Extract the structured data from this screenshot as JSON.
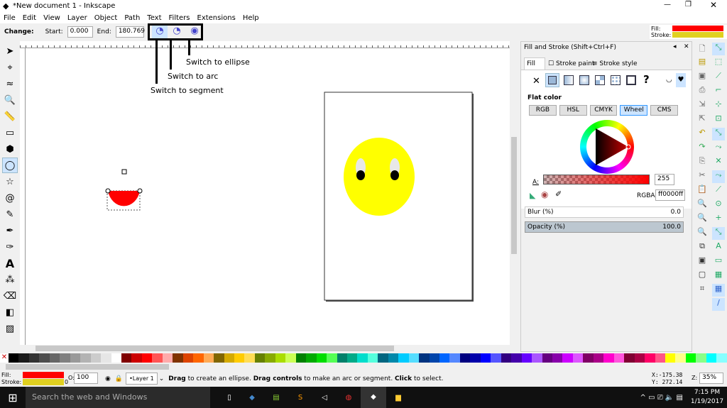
{
  "window": {
    "title": "*New document 1 - Inkscape"
  },
  "menu": [
    "File",
    "Edit",
    "View",
    "Layer",
    "Object",
    "Path",
    "Text",
    "Filters",
    "Extensions",
    "Help"
  ],
  "controls": {
    "change_label": "Change:",
    "start_label": "Start:",
    "start_value": "0.000",
    "end_label": "End:",
    "end_value": "180.769"
  },
  "annotations": {
    "ellipse": "Switch to ellipse",
    "arc": "Switch to arc",
    "segment": "Switch to segment"
  },
  "indicator": {
    "fill_label": "Fill:",
    "stroke_label": "Stroke:",
    "fill_color": "#ff0000",
    "stroke_color": "#e0d020"
  },
  "dock": {
    "title": "Fill and Stroke (Shift+Ctrl+F)",
    "tabs": [
      "Fill",
      "Stroke paint",
      "Stroke style"
    ],
    "paint_type": "Flat color",
    "modes": [
      "RGB",
      "HSL",
      "CMYK",
      "Wheel",
      "CMS"
    ],
    "active_mode": "Wheel",
    "alpha_label": "A:",
    "alpha_value": "255",
    "rgba_label": "RGBA:",
    "rgba_value": "ff0000ff",
    "blur_label": "Blur (%)",
    "blur_value": "0.0",
    "opacity_label": "Opacity (%)",
    "opacity_value": "100.0"
  },
  "status": {
    "fill_label": "Fill:",
    "stroke_label": "Stroke:",
    "stroke_width": "0",
    "opacity_label": "O:",
    "opacity_value": "100",
    "layer": "•Layer 1",
    "message_parts": [
      "Drag",
      " to create an ellipse. ",
      "Drag controls",
      " to make an arc or segment. ",
      "Click",
      " to select."
    ],
    "x_label": "X:",
    "x_value": "-175.38",
    "y_label": "Y:",
    "y_value": "272.14",
    "zoom_label": "Z:",
    "zoom_value": "35%"
  },
  "taskbar": {
    "search_placeholder": "Search the web and Windows",
    "time": "7:15 PM",
    "date": "1/19/2017"
  },
  "palette": [
    "#000000",
    "#1a1a1a",
    "#333",
    "#4d4d4d",
    "#666",
    "#808080",
    "#999",
    "#b3b3b3",
    "#ccc",
    "#e6e6e6",
    "#fff",
    "#800000",
    "#c00",
    "#f00",
    "#f55",
    "#faa",
    "#803300",
    "#d40",
    "#f60",
    "#fa5",
    "#806600",
    "#d4aa00",
    "#fc0",
    "#fd5",
    "#668000",
    "#8a0",
    "#ad0",
    "#cf5",
    "#008000",
    "#0a0",
    "#0d0",
    "#5f5",
    "#00806a",
    "#0a8",
    "#0dc",
    "#5fd",
    "#006680",
    "#08a",
    "#0cf",
    "#5df",
    "#003380",
    "#04a",
    "#06f",
    "#58f",
    "#000080",
    "#00a",
    "#00f",
    "#55f",
    "#330080",
    "#40a",
    "#60f",
    "#a5f",
    "#660080",
    "#80a",
    "#c0f",
    "#d5f",
    "#800066",
    "#a08",
    "#f0c",
    "#f5d",
    "#800033",
    "#a04",
    "#f06",
    "#f58",
    "#ff0",
    "#ff8",
    "#0f0",
    "#8f8",
    "#0ff",
    "#8ff"
  ]
}
